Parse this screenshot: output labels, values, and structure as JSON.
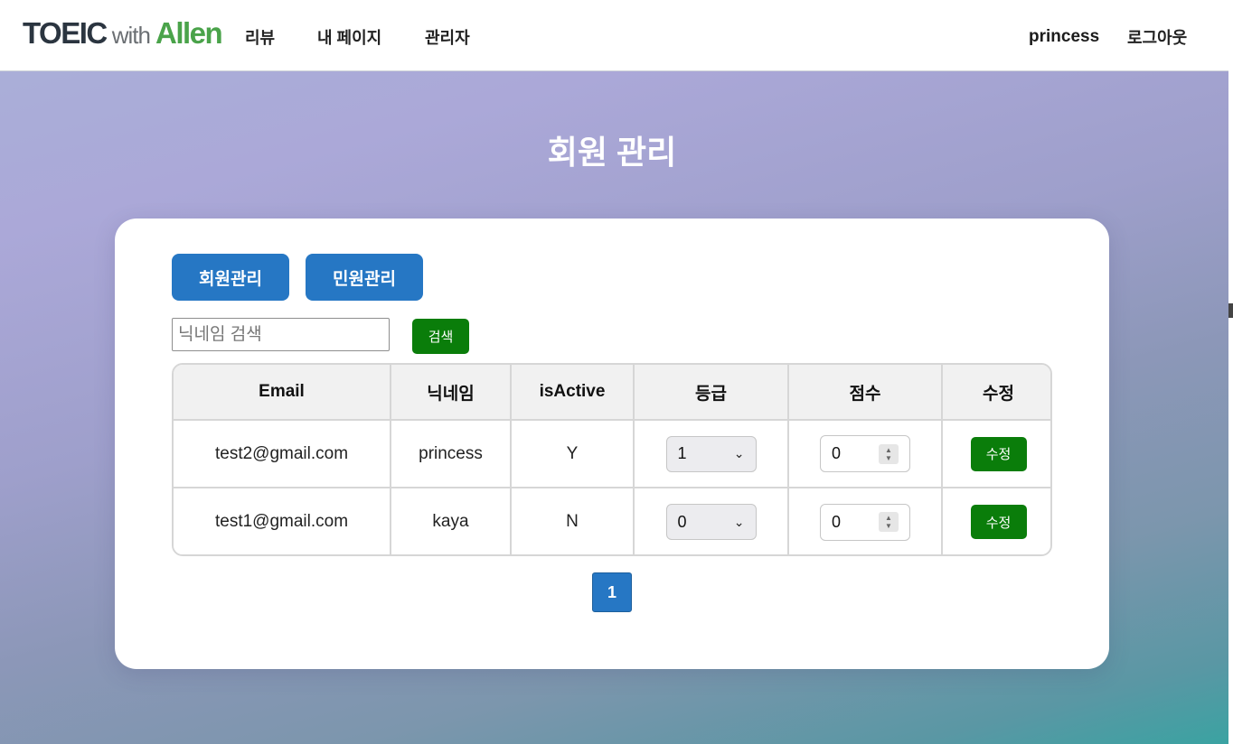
{
  "navbar": {
    "logo": {
      "part1": "TOEIC",
      "part2": "with",
      "part3": "Allen"
    },
    "links": {
      "review": "리뷰",
      "mypage": "내 페이지",
      "admin": "관리자"
    },
    "username": "princess",
    "logout": "로그아웃"
  },
  "page": {
    "title": "회원 관리"
  },
  "tabs": {
    "members": "회원관리",
    "complaints": "민원관리"
  },
  "search": {
    "placeholder": "닉네임 검색",
    "button": "검색"
  },
  "table": {
    "headers": [
      "Email",
      "닉네임",
      "isActive",
      "등급",
      "점수",
      "수정"
    ],
    "rows": [
      {
        "email": "test2@gmail.com",
        "nickname": "princess",
        "active": "Y",
        "grade": "1",
        "score": "0",
        "edit": "수정"
      },
      {
        "email": "test1@gmail.com",
        "nickname": "kaya",
        "active": "N",
        "grade": "0",
        "score": "0",
        "edit": "수정"
      }
    ]
  },
  "pagination": {
    "current": "1"
  },
  "colors": {
    "primary": "#2677c4",
    "success": "#0a7d0a",
    "logo_accent": "#4aa34a"
  }
}
